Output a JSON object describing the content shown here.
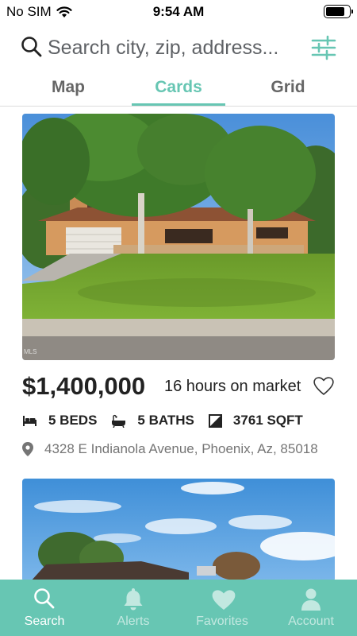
{
  "status_bar": {
    "carrier": "No SIM",
    "time": "9:54 AM",
    "battery_level": 0.85
  },
  "search": {
    "placeholder": "Search city, zip, address...",
    "value": ""
  },
  "tabs": [
    {
      "label": "Map",
      "active": false
    },
    {
      "label": "Cards",
      "active": true
    },
    {
      "label": "Grid",
      "active": false
    }
  ],
  "listings": [
    {
      "photo_watermark": "MLS",
      "price": "$1,400,000",
      "market_time": "16 hours on market",
      "beds": "5 BEDS",
      "baths": "5 BATHS",
      "sqft": "3761 SQFT",
      "address": "4328 E Indianola Avenue, Phoenix, Az, 85018"
    }
  ],
  "bottom_nav": [
    {
      "label": "Search",
      "icon": "search-icon",
      "active": true
    },
    {
      "label": "Alerts",
      "icon": "bell-icon",
      "active": false
    },
    {
      "label": "Favorites",
      "icon": "heart-icon",
      "active": false
    },
    {
      "label": "Account",
      "icon": "person-icon",
      "active": false
    }
  ],
  "colors": {
    "accent": "#67c6b3",
    "text": "#222222",
    "muted": "#757575"
  }
}
